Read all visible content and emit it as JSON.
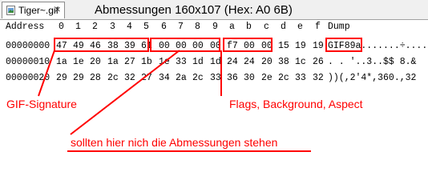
{
  "tab": {
    "title": "Tiger~.gif",
    "close_glyph": "×",
    "icon": "gif-file-icon"
  },
  "annotation_title": "Abmessungen 160x107 (Hex: A0 6B)",
  "columns": [
    "Address",
    "0",
    "1",
    "2",
    "3",
    "4",
    "5",
    "6",
    "7",
    "8",
    "9",
    "a",
    "b",
    "c",
    "d",
    "e",
    "f",
    "Dump"
  ],
  "rows": [
    {
      "address": "00000000",
      "bytes": [
        "47",
        "49",
        "46",
        "38",
        "39",
        "61",
        "00",
        "00",
        "00",
        "00",
        "f7",
        "00",
        "00",
        "15",
        "19",
        "19"
      ],
      "dump": "GIF89a.......÷....."
    },
    {
      "address": "00000010",
      "bytes": [
        "1a",
        "1e",
        "20",
        "1a",
        "27",
        "1b",
        "1e",
        "33",
        "1d",
        "1d",
        "24",
        "24",
        "20",
        "38",
        "1c",
        "26"
      ],
      "dump": ". . '..3..$$ 8.&"
    },
    {
      "address": "00000020",
      "bytes": [
        "29",
        "29",
        "28",
        "2c",
        "32",
        "27",
        "34",
        "2a",
        "2c",
        "33",
        "36",
        "30",
        "2e",
        "2c",
        "33",
        "32"
      ],
      "dump": "))(,2'4*,360.,32"
    }
  ],
  "annotations": {
    "signature_label": "GIF-Signature",
    "flags_label": "Flags, Background, Aspect",
    "dimensions_label": "sollten hier nich die Abmessungen stehen"
  },
  "colors": {
    "annotation": "#ff0000"
  }
}
